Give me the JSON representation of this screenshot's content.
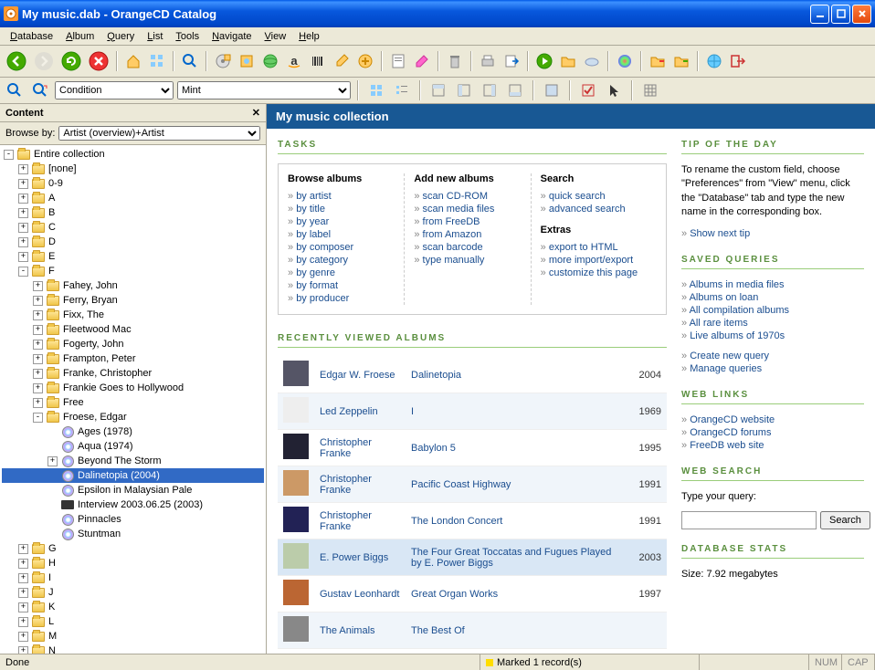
{
  "window": {
    "title": "My music.dab - OrangeCD Catalog"
  },
  "menu": [
    "Database",
    "Album",
    "Query",
    "List",
    "Tools",
    "Navigate",
    "View",
    "Help"
  ],
  "filter": {
    "field": "Condition",
    "value": "Mint"
  },
  "sidebar": {
    "header": "Content",
    "browse_label": "Browse by:",
    "browse_value": "Artist (overview)+Artist",
    "root": "Entire collection",
    "top_folders": [
      "[none]",
      "0-9",
      "A",
      "B",
      "C",
      "D",
      "E"
    ],
    "f_folder": "F",
    "f_artists": [
      "Fahey, John",
      "Ferry, Bryan",
      "Fixx, The",
      "Fleetwood Mac",
      "Fogerty, John",
      "Frampton, Peter",
      "Franke, Christopher",
      "Frankie Goes to Hollywood",
      "Free"
    ],
    "froese": "Froese, Edgar",
    "froese_albums": [
      "Ages (1978)",
      "Aqua (1974)",
      "Beyond The Storm",
      "Dalinetopia (2004)",
      "Epsilon in Malaysian Pale",
      "Interview 2003.06.25 (2003)",
      "Pinnacles",
      "Stuntman"
    ],
    "selected_index": 3,
    "bottom_folders": [
      "G",
      "H",
      "I",
      "J",
      "K",
      "L",
      "M",
      "N"
    ]
  },
  "content": {
    "header": "My music collection",
    "tasks_title": "TASKS",
    "tasks": {
      "browse": {
        "title": "Browse albums",
        "items": [
          "by artist",
          "by title",
          "by year",
          "by label",
          "by composer",
          "by category",
          "by genre",
          "by format",
          "by producer"
        ]
      },
      "add": {
        "title": "Add new albums",
        "items": [
          "scan CD-ROM",
          "scan media files",
          "from FreeDB",
          "from Amazon",
          "scan barcode",
          "type manually"
        ]
      },
      "search": {
        "title": "Search",
        "items": [
          "quick search",
          "advanced search"
        ]
      },
      "extras": {
        "title": "Extras",
        "items": [
          "export to HTML",
          "more import/export",
          "customize this page"
        ]
      }
    },
    "recent_title": "RECENTLY VIEWED ALBUMS",
    "recent": [
      {
        "artist": "Edgar W. Froese",
        "album": "Dalinetopia",
        "year": "2004"
      },
      {
        "artist": "Led Zeppelin",
        "album": "I",
        "year": "1969"
      },
      {
        "artist": "Christopher Franke",
        "album": "Babylon 5",
        "year": "1995"
      },
      {
        "artist": "Christopher Franke",
        "album": "Pacific Coast Highway",
        "year": "1991"
      },
      {
        "artist": "Christopher Franke",
        "album": "The London Concert",
        "year": "1991"
      },
      {
        "artist": "E. Power Biggs",
        "album": "The Four Great Toccatas and Fugues Played by E. Power Biggs",
        "year": "2003",
        "hl": true
      },
      {
        "artist": "Gustav Leonhardt",
        "album": "Great Organ Works",
        "year": "1997"
      },
      {
        "artist": "The Animals",
        "album": "The Best Of",
        "year": ""
      }
    ]
  },
  "side": {
    "tip_title": "TIP OF THE DAY",
    "tip_text": "To rename the custom field, choose \"Preferences\" from \"View\" menu, click the \"Database\" tab and type the new name in the corresponding box.",
    "tip_link": "Show next tip",
    "queries_title": "SAVED QUERIES",
    "queries": [
      "Albums in media files",
      "Albums on loan",
      "All compilation albums",
      "All rare items",
      "Live albums of 1970s"
    ],
    "queries_actions": [
      "Create new query",
      "Manage queries"
    ],
    "links_title": "WEB LINKS",
    "links": [
      "OrangeCD website",
      "OrangeCD forums",
      "FreeDB web site"
    ],
    "search_title": "WEB SEARCH",
    "search_label": "Type your query:",
    "search_btn": "Search",
    "stats_title": "DATABASE STATS",
    "stats_text": "Size: 7.92 megabytes"
  },
  "status": {
    "left": "Done",
    "marked": "Marked 1 record(s)",
    "num": "NUM",
    "cap": "CAP"
  }
}
